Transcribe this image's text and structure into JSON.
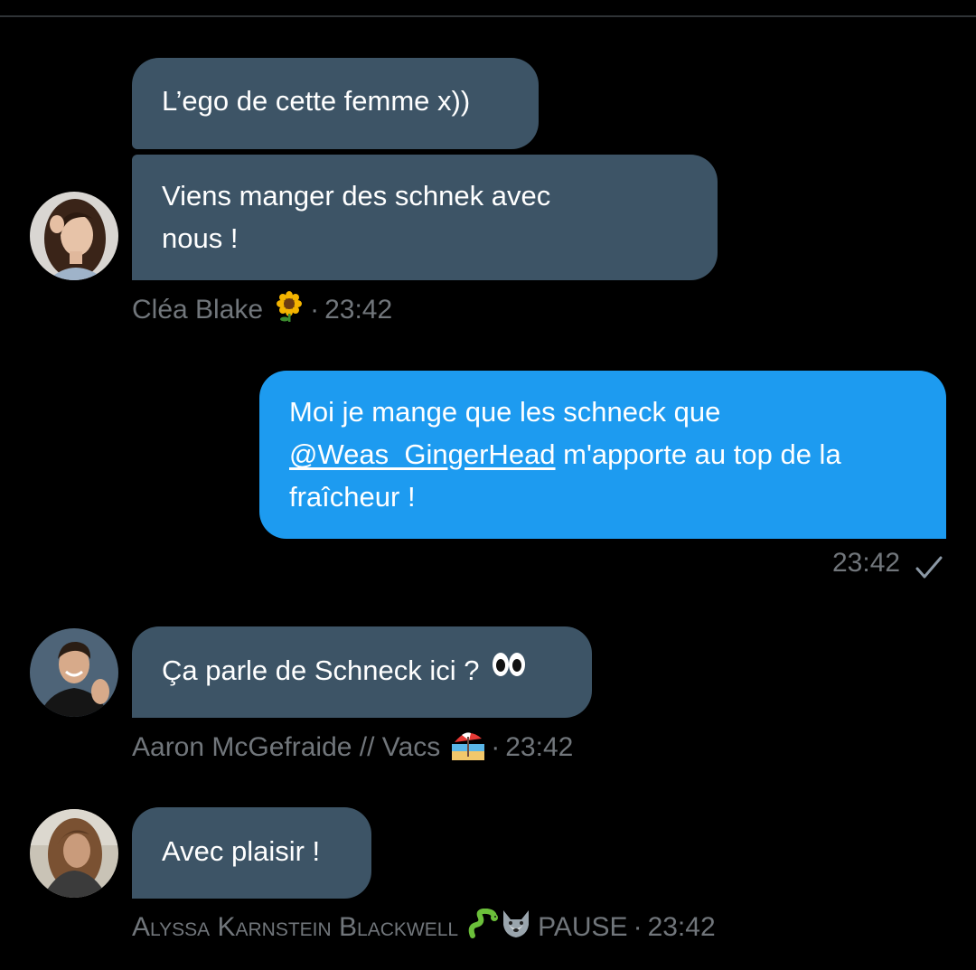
{
  "messages": [
    {
      "sender": "Cléa Blake",
      "sender_emoji_icon": "sunflower-icon",
      "time": "23:42",
      "bubbles": [
        "L’ego de cette femme x))",
        "Viens manger des schnek avec",
        "nous !"
      ]
    },
    {
      "sender": "me",
      "time": "23:42",
      "status_icon": "checkmark-icon",
      "text_line1": "Moi je mange que les schneck que",
      "mention": "@Weas_GingerHead",
      "text_line2_rest": "m'apporte au top de la",
      "text_line3": "fraîcheur !"
    },
    {
      "sender": "Aaron McGefraide // Vacs",
      "sender_emoji_icon": "beach-umbrella-icon",
      "time": "23:42",
      "text": "Ça parle de Schneck ici ?",
      "text_emoji_icon": "eyes-icon"
    },
    {
      "sender": "Alyssa Karnstein Blackwell",
      "sender_emoji_icons": [
        "snake-icon",
        "wolf-icon"
      ],
      "sender_suffix": "PAUSE",
      "time": "23:42",
      "text": "Avec plaisir !"
    }
  ],
  "separator": "·",
  "colors": {
    "background": "#000000",
    "incoming_bubble": "#3d5466",
    "outgoing_bubble": "#1d9bf0",
    "meta_text": "#71767b"
  }
}
